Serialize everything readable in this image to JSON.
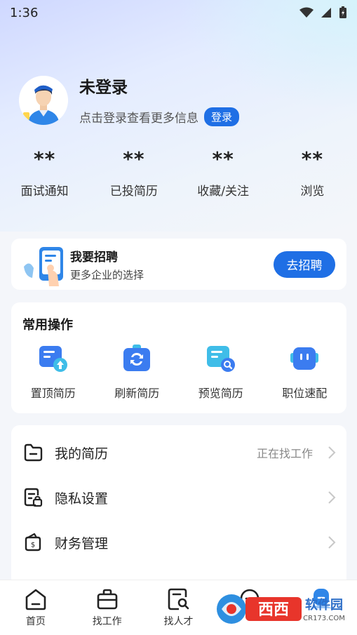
{
  "status_bar": {
    "time": "1:36"
  },
  "profile": {
    "name": "未登录",
    "subtitle": "点击登录查看更多信息",
    "login_badge": "登录"
  },
  "stats": [
    {
      "value": "**",
      "label": "面试通知"
    },
    {
      "value": "**",
      "label": "已投简历"
    },
    {
      "value": "**",
      "label": "收藏/关注"
    },
    {
      "value": "**",
      "label": "浏览"
    }
  ],
  "recruit": {
    "title": "我要招聘",
    "subtitle": "更多企业的选择",
    "button": "去招聘"
  },
  "operations": {
    "title": "常用操作",
    "items": [
      {
        "label": "置顶简历",
        "icon": "pin-resume-icon"
      },
      {
        "label": "刷新简历",
        "icon": "refresh-resume-icon"
      },
      {
        "label": "预览简历",
        "icon": "preview-resume-icon"
      },
      {
        "label": "职位速配",
        "icon": "job-match-icon"
      }
    ]
  },
  "menu": [
    {
      "label": "我的简历",
      "extra": "正在找工作",
      "icon": "folder-icon"
    },
    {
      "label": "隐私设置",
      "extra": "",
      "icon": "privacy-lock-icon"
    },
    {
      "label": "财务管理",
      "extra": "",
      "icon": "wallet-icon"
    }
  ],
  "tabbar": [
    {
      "label": "首页",
      "icon": "home-icon"
    },
    {
      "label": "找工作",
      "icon": "briefcase-icon"
    },
    {
      "label": "找人才",
      "icon": "talent-search-icon"
    },
    {
      "label": "",
      "icon": "message-icon"
    },
    {
      "label": "",
      "icon": "profile-icon"
    }
  ],
  "watermark": {
    "text": "西西软件园",
    "sub": "CR173.COM"
  },
  "colors": {
    "accent": "#1f6fe5",
    "icon_blue": "#3b7cf0",
    "icon_cyan": "#3fbde8"
  }
}
